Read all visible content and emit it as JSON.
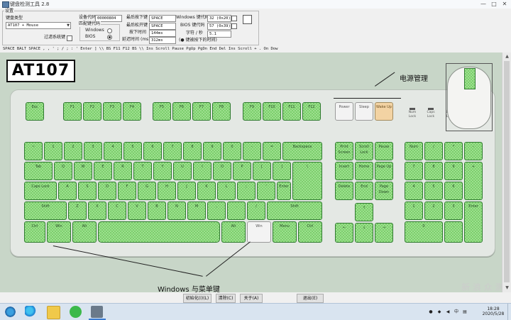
{
  "window": {
    "title": "键盘检测工具 2.8",
    "minimize": "—",
    "maximize": "□",
    "close": "✕"
  },
  "settings": {
    "group_label": "设置",
    "kbd_type_label": "键盘类型",
    "kbd_type_value": "AT107 + Mouse",
    "filter_label": "过滤系统键",
    "scancode_label": "设备代码",
    "scancode_value": "00000804",
    "mode_group_label": "匹配键代码",
    "mode_windows": "Windows",
    "mode_bios": "BIOS",
    "last_down_label": "最后按下键",
    "last_down_value": "SPACE",
    "last_up_label": "最后松开键",
    "last_up_value": "SPACE",
    "hold_time_label": "按下时间",
    "hold_time_value": "144ms",
    "delay_label": "延迟时间",
    "delay_unit_label": "(ms)",
    "delay_value": "312ms",
    "win_code_label": "Windows 键代码",
    "win_code_value": "32 (0x20)",
    "bios_code_label": "BIOS 键代码",
    "bios_code_value": "57 (0x39)",
    "rate_label": "字符 / 秒",
    "rate_value": "5.1",
    "count_label": "(● 键被按下的时间)"
  },
  "key_sequence": "SPACE BALT SPACE , , ' ; / ; : ' Enter ] \\\\ BS F11 F12 BS \\\\ Ins Scroll Pause PgUp PgDn End Del Ins Scroll + . On Dow",
  "keyboard": {
    "model": "AT107",
    "annotation_power": "电源管理",
    "annotation_windows": "Windows 与菜单键",
    "power_keys": [
      "Power",
      "Sleep",
      "Wake Up"
    ],
    "indicators": [
      "Num Lock",
      "Caps Lock",
      "Scroll Lock"
    ],
    "row1": [
      "Esc",
      "F1",
      "F2",
      "F3",
      "F4",
      "F5",
      "F6",
      "F7",
      "F8",
      "F9",
      "F10",
      "F11",
      "F12"
    ],
    "row2": [
      "~",
      "1",
      "2",
      "3",
      "4",
      "5",
      "6",
      "7",
      "8",
      "9",
      "0",
      "-",
      "=",
      "Backspace"
    ],
    "row3": [
      "Tab",
      "Q",
      "W",
      "E",
      "R",
      "T",
      "Y",
      "U",
      "I",
      "O",
      "P",
      "[",
      "]",
      "\\"
    ],
    "row4": [
      "Caps Lock",
      "A",
      "S",
      "D",
      "F",
      "G",
      "H",
      "J",
      "K",
      "L",
      ";",
      "'",
      "Enter"
    ],
    "row5": [
      "Shift",
      "Z",
      "X",
      "C",
      "V",
      "B",
      "N",
      "M",
      ",",
      ".",
      "/",
      "Shift"
    ],
    "row6": [
      "Ctrl",
      "Win",
      "Alt",
      "",
      "Alt",
      "Win",
      "Menu",
      "Ctrl"
    ],
    "nav1": [
      "Print Screen",
      "Scroll Lock",
      "Pause"
    ],
    "nav2": [
      "Insert",
      "Home",
      "Page Up"
    ],
    "nav3": [
      "Delete",
      "End",
      "Page Down"
    ],
    "arrows": [
      "↑",
      "←",
      "↓",
      "→"
    ],
    "numpad": [
      "Num",
      "/",
      "*",
      "-",
      "7",
      "8",
      "9",
      "+",
      "4",
      "5",
      "6",
      "1",
      "2",
      "3",
      "Enter",
      "0",
      "."
    ]
  },
  "buttons": {
    "reset": "初始化(I)(L)",
    "clear": "清除(C)",
    "about": "关于(A)",
    "exit": "退出(E)"
  },
  "taskbar": {
    "time": "18:28",
    "date": "2020/5/28",
    "ime": "中",
    "watermark": "新 浪 众 测"
  },
  "colors": {
    "key_active": "#9ddf8f",
    "key_pattern": "#7ccf6c",
    "key_orange": "#f3d3a3",
    "key_plain": "#f3f3f3",
    "taskbar": "#d9e4f0"
  }
}
